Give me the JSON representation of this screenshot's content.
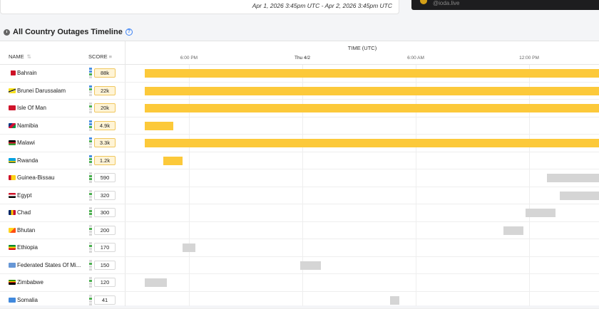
{
  "header": {
    "date_range": "Apr 1, 2026 3:45pm UTC - Apr 2, 2026 3:45pm UTC",
    "social_handle": "@ioda.live"
  },
  "section": {
    "title": "All Country Outages Timeline",
    "help": "?"
  },
  "table": {
    "col_name": "NAME",
    "col_score": "SCORE",
    "name_sort_glyph": "⇅",
    "score_sort_glyph": "≡"
  },
  "timeline": {
    "title": "TIME (UTC)",
    "ticks": [
      "6:00 PM",
      "Thu 4/2",
      "6:00 AM",
      "12:00 PM"
    ]
  },
  "colors": {
    "high_outage": "#fcc93a",
    "low_outage": "#d5d5d5",
    "indicator_green": "#4caf50",
    "indicator_blue": "#4a90e2"
  },
  "rows": [
    {
      "name": "Bahrain",
      "score": "88k",
      "level": "high"
    },
    {
      "name": "Brunei Darussalam",
      "score": "22k",
      "level": "high"
    },
    {
      "name": "Isle Of Man",
      "score": "20k",
      "level": "high"
    },
    {
      "name": "Namibia",
      "score": "4.9k",
      "level": "high"
    },
    {
      "name": "Malawi",
      "score": "3.3k",
      "level": "high"
    },
    {
      "name": "Rwanda",
      "score": "1.2k",
      "level": "high"
    },
    {
      "name": "Guinea-Bissau",
      "score": "590",
      "level": "low"
    },
    {
      "name": "Egypt",
      "score": "320",
      "level": "low"
    },
    {
      "name": "Chad",
      "score": "300",
      "level": "low"
    },
    {
      "name": "Bhutan",
      "score": "200",
      "level": "low"
    },
    {
      "name": "Ethiopia",
      "score": "170",
      "level": "low"
    },
    {
      "name": "Federated States Of Mi...",
      "score": "150",
      "level": "low"
    },
    {
      "name": "Zimbabwe",
      "score": "120",
      "level": "low"
    },
    {
      "name": "Somalia",
      "score": "41",
      "level": "low"
    }
  ]
}
